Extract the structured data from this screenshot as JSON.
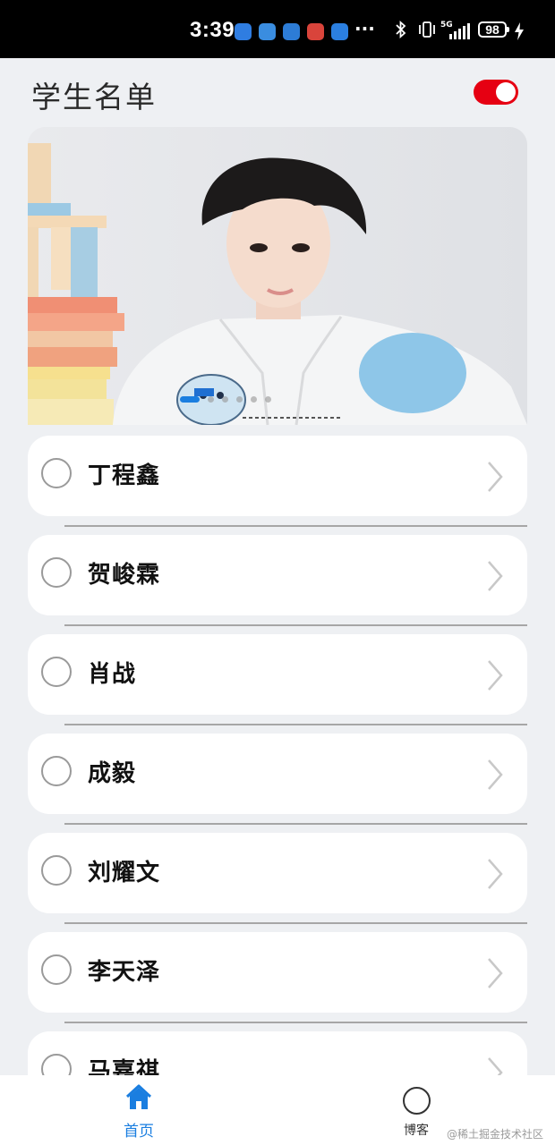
{
  "status_bar": {
    "time": "3:39",
    "more": "···",
    "network": "5G",
    "battery": "98",
    "notification_icons": [
      {
        "name": "usb-notification-icon",
        "color": "#2f7de1"
      },
      {
        "name": "app-notification-icon",
        "color": "#3a8de0"
      },
      {
        "name": "app2-notification-icon",
        "color": "#2d7cd6"
      },
      {
        "name": "mail-notification-icon",
        "color": "#d9443b"
      },
      {
        "name": "message-notification-icon",
        "color": "#2b7fe0"
      }
    ]
  },
  "header": {
    "title": "学生名单",
    "toggle_on": true,
    "toggle_color": "#e60012"
  },
  "banner": {
    "image": "portrait-photo",
    "page_count": 6,
    "active_index": 0
  },
  "students": [
    {
      "name": "丁程鑫"
    },
    {
      "name": "贺峻霖"
    },
    {
      "name": "肖战"
    },
    {
      "name": "成毅"
    },
    {
      "name": "刘耀文"
    },
    {
      "name": "李天泽"
    },
    {
      "name": "马嘉祺"
    }
  ],
  "bottom_nav": {
    "home_label": "首页",
    "blog_label": "博客",
    "accent": "#1a7ee0"
  },
  "watermark": "@稀土掘金技术社区"
}
